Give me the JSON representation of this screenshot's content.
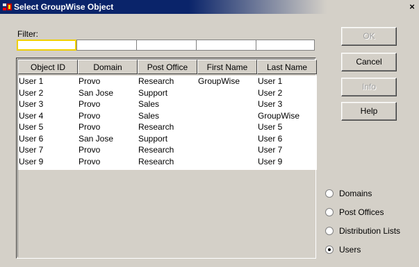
{
  "window": {
    "title": "Select GroupWise Object",
    "close_label": "×"
  },
  "filter": {
    "label": "Filter:",
    "values": [
      "",
      "",
      "",
      "",
      ""
    ]
  },
  "table": {
    "columns": [
      "Object ID",
      "Domain",
      "Post Office",
      "First Name",
      "Last Name"
    ],
    "rows": [
      [
        "User 1",
        "Provo",
        "Research",
        "GroupWise",
        "User 1"
      ],
      [
        "User 2",
        "San Jose",
        "Support",
        "",
        "User 2"
      ],
      [
        "User 3",
        "Provo",
        "Sales",
        "",
        "User 3"
      ],
      [
        "User 4",
        "Provo",
        "Sales",
        "",
        "GroupWise"
      ],
      [
        "User 5",
        "Provo",
        "Research",
        "",
        "User 5"
      ],
      [
        "User 6",
        "San Jose",
        "Support",
        "",
        "User 6"
      ],
      [
        "User 7",
        "Provo",
        "Research",
        "",
        "User 7"
      ],
      [
        "User 9",
        "Provo",
        "Research",
        "",
        "User 9"
      ]
    ]
  },
  "buttons": {
    "ok": "OK",
    "cancel": "Cancel",
    "info": "Info",
    "help": "Help"
  },
  "object_type": {
    "options": [
      "Domains",
      "Post Offices",
      "Distribution Lists",
      "Users"
    ],
    "selected": "Users"
  },
  "colors": {
    "titlebar": "#0a246a",
    "window_bg": "#d4d0c8",
    "filter_focus": "#f0d000"
  }
}
